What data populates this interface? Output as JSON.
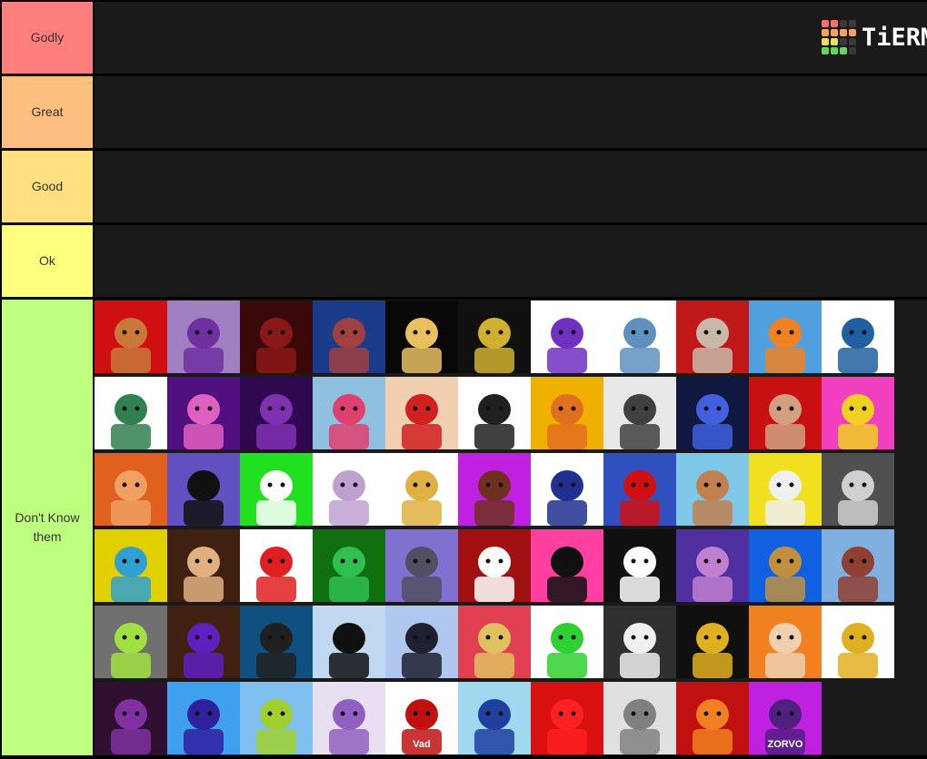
{
  "logo": {
    "text": "TiERMAKER",
    "grid_colors": [
      [
        "#f87070",
        "#f87070",
        "#3a3a3a",
        "#3a3a3a"
      ],
      [
        "#f8a060",
        "#f8a060",
        "#f8a060",
        "#f8a060"
      ],
      [
        "#f0e060",
        "#f0e060",
        "#3a3a3a",
        "#3a3a3a"
      ],
      [
        "#60d860",
        "#60d860",
        "#60d860",
        "#3a3a3a"
      ]
    ]
  },
  "tiers": [
    {
      "label": "Godly",
      "color": "#ff7f7f",
      "items": []
    },
    {
      "label": "Great",
      "color": "#ffbf7f",
      "items": []
    },
    {
      "label": "Good",
      "color": "#ffdf7f",
      "items": []
    },
    {
      "label": "Ok",
      "color": "#ffff7f",
      "items": []
    },
    {
      "label": "Don't Know them",
      "color": "#bfff7f",
      "items": [
        {
          "name": "red-hat-bird-avatar",
          "bg": "#d01010",
          "fg": "#c87838"
        },
        {
          "name": "purple-hoodie-headphones-avatar",
          "bg": "#a080c0",
          "fg": "#7030a0"
        },
        {
          "name": "spinning-red-dots-avatar",
          "bg": "#3a0808",
          "fg": "#8a1818"
        },
        {
          "name": "snowflake-wolf-avatar",
          "bg": "#1a3a8a",
          "fg": "#a04040"
        },
        {
          "name": "yellow-hat-coat-avatar",
          "bg": "#080808",
          "fg": "#e8c060"
        },
        {
          "name": "stacked-noob-tower-avatar",
          "bg": "#101010",
          "fg": "#d0b030"
        },
        {
          "name": "purple-hair-antlers-avatar",
          "bg": "#ffffff",
          "fg": "#7030c0"
        },
        {
          "name": "blurred-blue-avatar",
          "bg": "#ffffff",
          "fg": "#6090c0"
        },
        {
          "name": "mustache-beanie-avatar",
          "bg": "#c01818",
          "fg": "#c8b8a8"
        },
        {
          "name": "orange-top-hat-avatar",
          "bg": "#50a0e0",
          "fg": "#f08020"
        },
        {
          "name": "blue-beanie-drawing-avatar",
          "bg": "#ffffff",
          "fg": "#2060a0"
        },
        {
          "name": "green-hair-drawing-avatar",
          "bg": "#ffffff",
          "fg": "#308050"
        },
        {
          "name": "pink-hair-purple-avatar",
          "bg": "#501080",
          "fg": "#e060c0"
        },
        {
          "name": "purple-hood-ears-avatar",
          "bg": "#300850",
          "fg": "#8030b0"
        },
        {
          "name": "pink-spiky-hair-avatar",
          "bg": "#90c0e0",
          "fg": "#e04070"
        },
        {
          "name": "mask-red-hat-avatar",
          "bg": "#f0d0b0",
          "fg": "#d02020"
        },
        {
          "name": "sketch-lounging-avatar",
          "bg": "#ffffff",
          "fg": "#202020"
        },
        {
          "name": "orange-blond-avatar",
          "bg": "#f0b000",
          "fg": "#e07020"
        },
        {
          "name": "fizzy-lol-avatar",
          "bg": "#e8e8e8",
          "fg": "#404040"
        },
        {
          "name": "blue-parka-goggles-avatar",
          "bg": "#101840",
          "fg": "#4060e0"
        },
        {
          "name": "red-hair-goggles-avatar",
          "bg": "#c81010",
          "fg": "#d0a080"
        },
        {
          "name": "orange-helmet-yellow-avatar",
          "bg": "#f040c0",
          "fg": "#f0d020"
        },
        {
          "name": "orange-wings-anime-avatar",
          "bg": "#e06020",
          "fg": "#f0a060"
        },
        {
          "name": "black-hoodie-smoke-avatar",
          "bg": "#6050c0",
          "fg": "#101010"
        },
        {
          "name": "green-cap-avatar",
          "bg": "#20e020",
          "fg": "#ffffff"
        },
        {
          "name": "pirate-hat-sketch-avatar",
          "bg": "#ffffff",
          "fg": "#c0a0d0"
        },
        {
          "name": "antler-blond-anime-avatar",
          "bg": "#ffffff",
          "fg": "#e0b040"
        },
        {
          "name": "purple-goblin-avatar",
          "bg": "#c020e0",
          "fg": "#703020"
        },
        {
          "name": "blue-hood-skull-avatar",
          "bg": "#ffffff",
          "fg": "#203090"
        },
        {
          "name": "red-hoodie-spiky-avatar",
          "bg": "#3050c0",
          "fg": "#d01010"
        },
        {
          "name": "grinning-head-avatar",
          "bg": "#80c8e8",
          "fg": "#c08050"
        },
        {
          "name": "yellow-blond-avatar",
          "bg": "#f0e020",
          "fg": "#f0f0f0"
        },
        {
          "name": "grey-m-shirt-avatar",
          "bg": "#505050",
          "fg": "#d0d0d0"
        },
        {
          "name": "blue-hair-lego-avatar",
          "bg": "#e0d000",
          "fg": "#30a0d0"
        },
        {
          "name": "closeup-hat-avatar",
          "bg": "#402010",
          "fg": "#e0b080"
        },
        {
          "name": "red-cap-item-avatar",
          "bg": "#ffffff",
          "fg": "#e02020"
        },
        {
          "name": "green-top-hat-logo-avatar",
          "bg": "#107010",
          "fg": "#30c050"
        },
        {
          "name": "antler-grey-avatar",
          "bg": "#8070d0",
          "fg": "#505060"
        },
        {
          "name": "red-hood-frown-avatar",
          "bg": "#a01010",
          "fg": "#ffffff"
        },
        {
          "name": "pink-smiley-avatar",
          "bg": "#ff40a0",
          "fg": "#101010"
        },
        {
          "name": "guest-cap-avatar",
          "bg": "#101010",
          "fg": "#ffffff"
        },
        {
          "name": "galaxy-purple-avatar",
          "bg": "#5030a0",
          "fg": "#c080d0"
        },
        {
          "name": "cat-ears-rainbow-avatar",
          "bg": "#1060e0",
          "fg": "#c09040"
        },
        {
          "name": "red-suit-sitting-avatar",
          "bg": "#80b0e0",
          "fg": "#904030"
        },
        {
          "name": "green-hair-hood-avatar",
          "bg": "#707070",
          "fg": "#a0e040"
        },
        {
          "name": "purple-scarf-shades-avatar",
          "bg": "#402010",
          "fg": "#6020c0"
        },
        {
          "name": "dark-sword-avatar",
          "bg": "#105080",
          "fg": "#202020"
        },
        {
          "name": "antler-goggles-avatar",
          "bg": "#c0d8f0",
          "fg": "#101010"
        },
        {
          "name": "blue-cape-runner-avatar",
          "bg": "#b0c8f0",
          "fg": "#202030"
        },
        {
          "name": "pink-fedora-avatar",
          "bg": "#e04050",
          "fg": "#e0c060"
        },
        {
          "name": "green-shirt-medallion-avatar",
          "bg": "#ffffff",
          "fg": "#30d030"
        },
        {
          "name": "grey-gold-hat-avatar",
          "bg": "#303030",
          "fg": "#f0f0f0"
        },
        {
          "name": "dark-goggles-hat-avatar",
          "bg": "#101010",
          "fg": "#e0b020"
        },
        {
          "name": "anime-girls-avatar",
          "bg": "#f08020",
          "fg": "#f0d0b0"
        },
        {
          "name": "golden-hood-circle-avatar",
          "bg": "#ffffff",
          "fg": "#e0b020"
        },
        {
          "name": "purple-cat-witch-avatar",
          "bg": "#301030",
          "fg": "#8030a0"
        },
        {
          "name": "infinity-gauntlet-avatar",
          "bg": "#40a0f0",
          "fg": "#3020a0"
        },
        {
          "name": "green-yellow-noob-avatar",
          "bg": "#80c0f0",
          "fg": "#a0d030"
        },
        {
          "name": "purple-curly-hair-avatar",
          "bg": "#e8e0f0",
          "fg": "#9060c0"
        },
        {
          "name": "vad-text-avatar",
          "bg": "#ffffff",
          "fg": "#c01010",
          "text": "Vad"
        },
        {
          "name": "blue-hair-headphones-avatar",
          "bg": "#a0d8f0",
          "fg": "#2040a0"
        },
        {
          "name": "red-headphones-avatar",
          "bg": "#d81010",
          "fg": "#ff2020"
        },
        {
          "name": "rice-hat-sketch-avatar",
          "bg": "#e0e0e0",
          "fg": "#808080"
        },
        {
          "name": "orange-shirt-hands-avatar",
          "bg": "#c01010",
          "fg": "#f08020"
        },
        {
          "name": "zorvo-antler-avatar",
          "bg": "#c020e0",
          "fg": "#502080",
          "text": "ZORVO"
        }
      ]
    }
  ]
}
